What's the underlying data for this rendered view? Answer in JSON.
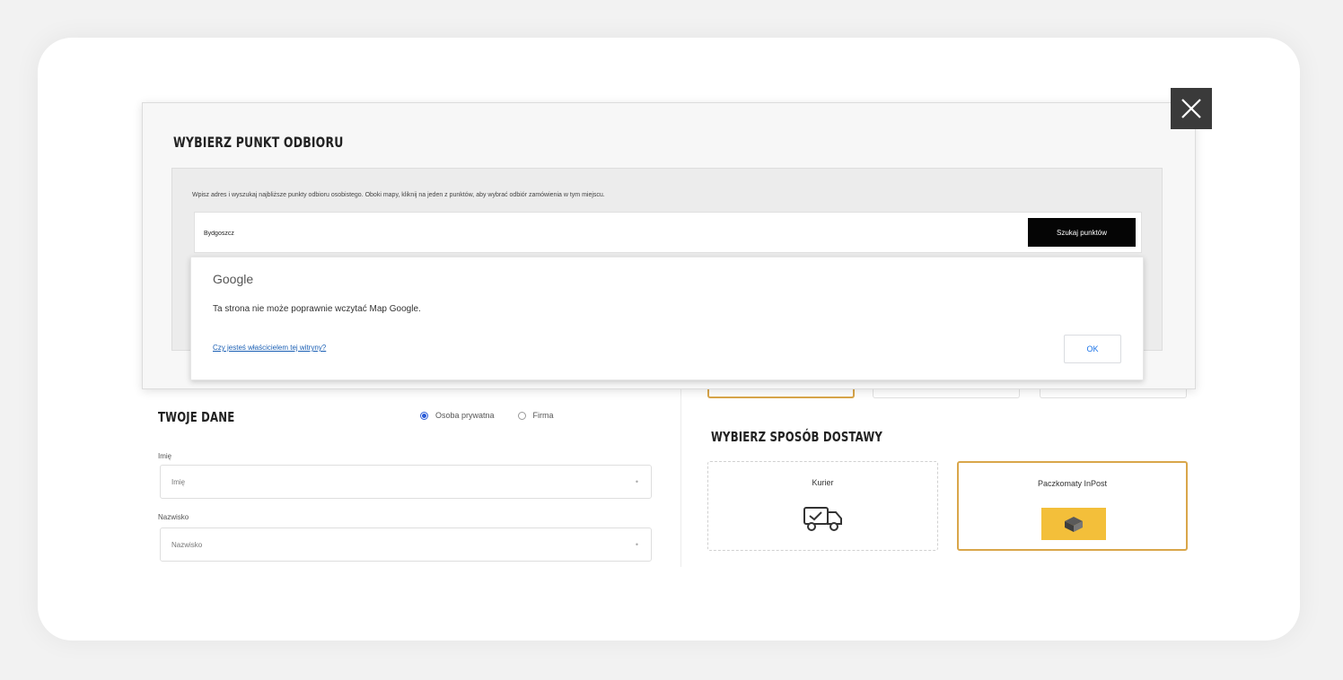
{
  "modal": {
    "title": "WYBIERZ PUNKT ODBIORU",
    "instructions": "Wpisz adres i wyszukaj najbliższe punkty odbioru osobistego. Oboki mapy, kliknij na jeden z punktów, aby wybrać odbiór zamówienia w tym miejscu.",
    "search_value": "Bydgoszcz",
    "search_button": "Szukaj punktów",
    "close_icon": "close-icon"
  },
  "google_dialog": {
    "brand": "Google",
    "message": "Ta strona nie może poprawnie wczytać Map Google.",
    "link": "Czy jesteś właścicielem tej witryny?",
    "ok_button": "OK"
  },
  "personal": {
    "title": "TWOJE DANE",
    "radio": [
      {
        "label": "Osoba prywatna",
        "checked": true
      },
      {
        "label": "Firma",
        "checked": false
      }
    ],
    "fields": [
      {
        "label": "Imię",
        "placeholder": "Imię"
      },
      {
        "label": "Nazwisko",
        "placeholder": "Nazwisko"
      }
    ]
  },
  "delivery": {
    "title": "WYBIERZ SPOSÓB DOSTAWY",
    "options": [
      {
        "label": "Kurier",
        "icon": "truck-icon",
        "selected": false
      },
      {
        "label": "Paczkomaty InPost",
        "icon": "inpost-locker-icon",
        "selected": true
      }
    ]
  },
  "colors": {
    "accent_gold": "#d9a64a",
    "inpost_yellow": "#f3bf3a",
    "button_black": "#050505",
    "link_blue": "#1a5fb4"
  }
}
